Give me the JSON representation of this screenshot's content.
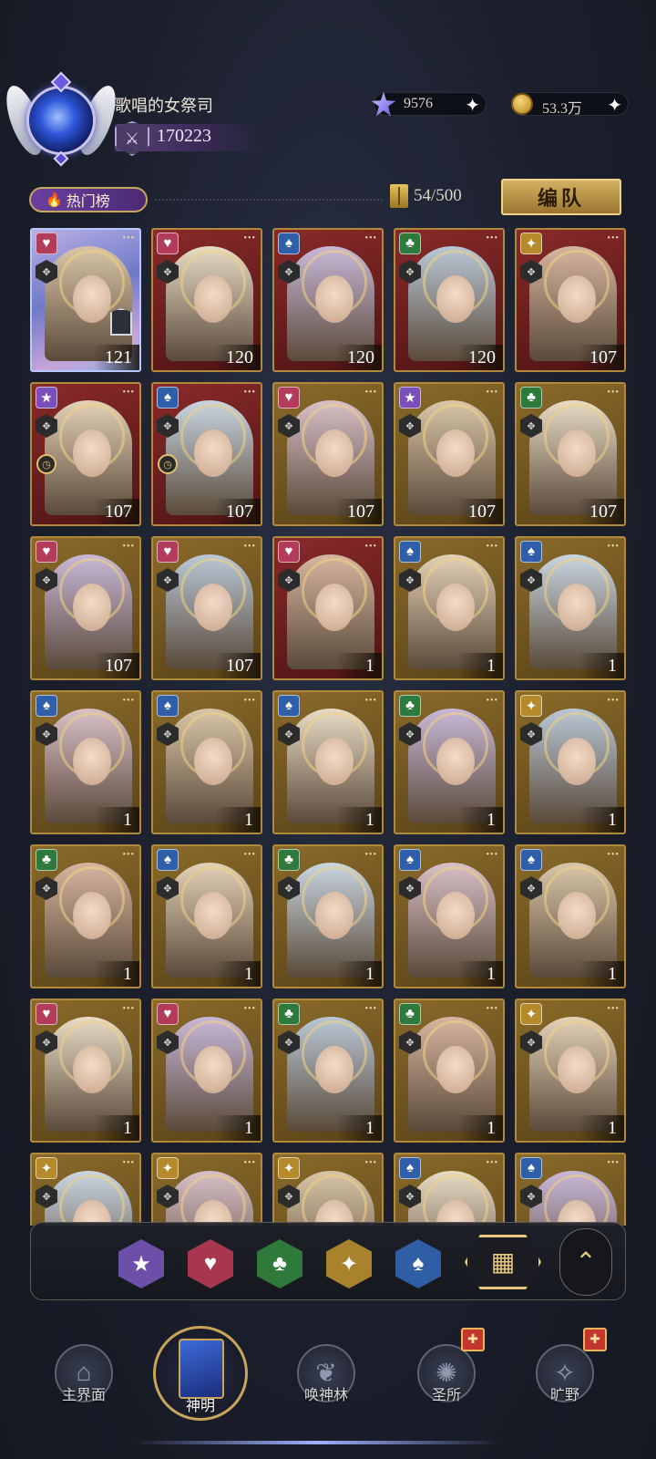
{
  "player": {
    "name": "歌唱的女祭司",
    "power": "170223"
  },
  "resources": [
    {
      "icon": "star-gem-icon",
      "value": "9576"
    },
    {
      "icon": "gold-coin-icon",
      "value": "53.3万"
    }
  ],
  "hot_list": {
    "label": "热门榜"
  },
  "capacity": {
    "value": "54/500"
  },
  "team_button": {
    "label": "编队"
  },
  "cards": [
    {
      "suit": "heart",
      "level": "121",
      "frame": "holo"
    },
    {
      "suit": "heart",
      "level": "120",
      "frame": "red"
    },
    {
      "suit": "spade",
      "level": "120",
      "frame": "red"
    },
    {
      "suit": "club",
      "level": "120",
      "frame": "red"
    },
    {
      "suit": "diamond",
      "level": "107",
      "frame": "red"
    },
    {
      "suit": "star",
      "level": "107",
      "frame": "red"
    },
    {
      "suit": "spade",
      "level": "107",
      "frame": "red"
    },
    {
      "suit": "heart",
      "level": "107",
      "frame": "gold"
    },
    {
      "suit": "star",
      "level": "107",
      "frame": "gold"
    },
    {
      "suit": "club",
      "level": "107",
      "frame": "gold"
    },
    {
      "suit": "heart",
      "level": "107",
      "frame": "gold"
    },
    {
      "suit": "heart",
      "level": "107",
      "frame": "gold"
    },
    {
      "suit": "heart",
      "level": "1",
      "frame": "red"
    },
    {
      "suit": "spade",
      "level": "1",
      "frame": "gold"
    },
    {
      "suit": "spade",
      "level": "1",
      "frame": "gold"
    },
    {
      "suit": "spade",
      "level": "1",
      "frame": "gold"
    },
    {
      "suit": "spade",
      "level": "1",
      "frame": "gold"
    },
    {
      "suit": "spade",
      "level": "1",
      "frame": "gold"
    },
    {
      "suit": "club",
      "level": "1",
      "frame": "gold"
    },
    {
      "suit": "diamond",
      "level": "1",
      "frame": "gold"
    },
    {
      "suit": "club",
      "level": "1",
      "frame": "gold"
    },
    {
      "suit": "spade",
      "level": "1",
      "frame": "gold"
    },
    {
      "suit": "club",
      "level": "1",
      "frame": "gold"
    },
    {
      "suit": "spade",
      "level": "1",
      "frame": "gold"
    },
    {
      "suit": "spade",
      "level": "1",
      "frame": "gold"
    },
    {
      "suit": "heart",
      "level": "1",
      "frame": "gold"
    },
    {
      "suit": "heart",
      "level": "1",
      "frame": "gold"
    },
    {
      "suit": "club",
      "level": "1",
      "frame": "gold"
    },
    {
      "suit": "club",
      "level": "1",
      "frame": "gold"
    },
    {
      "suit": "diamond",
      "level": "1",
      "frame": "gold"
    },
    {
      "suit": "diamond",
      "level": "",
      "frame": "gold"
    },
    {
      "suit": "diamond",
      "level": "",
      "frame": "gold"
    },
    {
      "suit": "diamond",
      "level": "",
      "frame": "gold"
    },
    {
      "suit": "spade",
      "level": "",
      "frame": "gold"
    },
    {
      "suit": "spade",
      "level": "",
      "frame": "gold"
    }
  ],
  "filters": [
    {
      "name": "star-filter",
      "glyph": "★",
      "color": "#6c4fa8"
    },
    {
      "name": "heart-filter",
      "glyph": "♥",
      "color": "#a8364f"
    },
    {
      "name": "club-filter",
      "glyph": "♣",
      "color": "#2f7a3a"
    },
    {
      "name": "diamond-filter",
      "glyph": "✦",
      "color": "#a8822c"
    },
    {
      "name": "spade-filter",
      "glyph": "♠",
      "color": "#2f5ea5"
    }
  ],
  "nav": {
    "main": "主界面",
    "gods": "神明",
    "summon": "唤神林",
    "sanctuary": "圣所",
    "wild": "旷野"
  },
  "colors": {
    "accent_gold": "#c9a55a",
    "heart": "#b33c5a",
    "spade": "#2f5fa8",
    "club": "#2e7a3c",
    "diamond": "#b58a2a",
    "star": "#7a4fb8"
  }
}
